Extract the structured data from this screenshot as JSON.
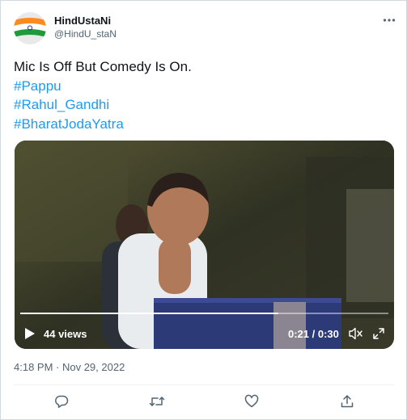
{
  "author": {
    "display_name": "HindUstaNi",
    "handle": "@HindU_staN",
    "avatar_icon": "india-flag-icon"
  },
  "tweet": {
    "text_line": "Mic Is Off But Comedy Is On.",
    "hashtags": [
      "#Pappu",
      "#Rahul_Gandhi",
      "#BharatJodaYatra"
    ],
    "timestamp": "4:18 PM · Nov 29, 2022"
  },
  "video": {
    "views_label": "44 views",
    "time_label": "0:21 / 0:30",
    "progress": 0.7,
    "controls": [
      "play-icon",
      "mute-icon",
      "expand-icon"
    ]
  },
  "actions": [
    "reply-icon",
    "retweet-icon",
    "like-icon",
    "share-icon"
  ],
  "colors": {
    "link": "#1d9bf0",
    "text": "#0f1419",
    "secondary": "#536471",
    "border": "#cfd9de"
  }
}
